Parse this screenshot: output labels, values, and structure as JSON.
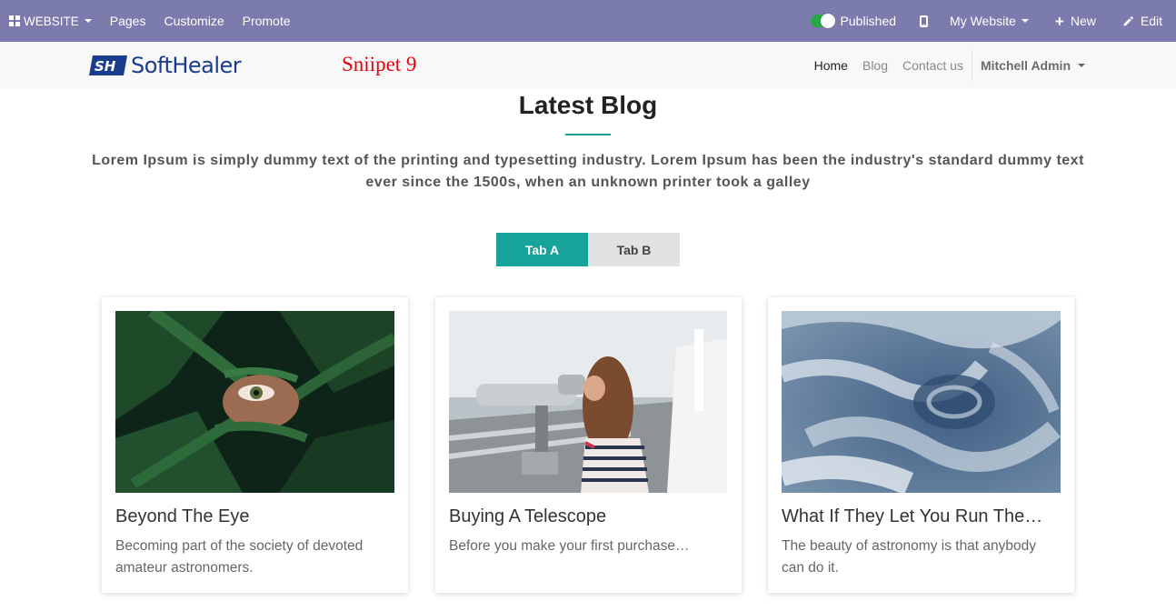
{
  "adminbar": {
    "website_label": "WEBSITE",
    "pages_label": "Pages",
    "customize_label": "Customize",
    "promote_label": "Promote",
    "published_label": "Published",
    "my_website_label": "My Website",
    "new_label": "New",
    "edit_label": "Edit",
    "published_on": true
  },
  "header": {
    "logo_text": "SoftHealer",
    "snippet_label": "Sniipet 9",
    "nav": [
      {
        "label": "Home"
      },
      {
        "label": "Blog"
      },
      {
        "label": "Contact us"
      }
    ],
    "user_label": "Mitchell Admin"
  },
  "section": {
    "title": "Latest Blog",
    "description": "Lorem Ipsum is simply dummy text of the printing and typesetting industry. Lorem Ipsum has been the industry's standard dummy text ever since the 1500s, when an unknown printer took a galley",
    "tabs": [
      {
        "label": "Tab A",
        "active": true
      },
      {
        "label": "Tab B",
        "active": false
      }
    ]
  },
  "cards": [
    {
      "title": "Beyond The Eye",
      "description": "Becoming part of the society of devoted amateur astronomers."
    },
    {
      "title": "Buying A Telescope",
      "description": "Before you make your first purchase…"
    },
    {
      "title": "What If They Let You Run The…",
      "description": "The beauty of astronomy is that anybody can do it."
    }
  ],
  "colors": {
    "admin_bar": "#7c7bad",
    "accent": "#17a29a",
    "snippet_red": "#e8000b",
    "logo_blue": "#1a3c8c"
  }
}
